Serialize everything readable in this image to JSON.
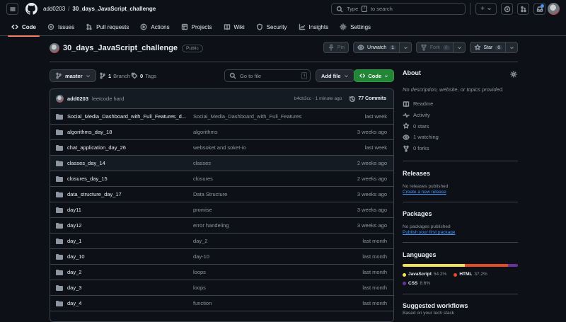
{
  "header": {
    "owner": "add0203",
    "separator": "/",
    "repo": "30_days_JavaScript_challenge",
    "search_prefix": "Type",
    "search_key": "/",
    "search_suffix": "to search",
    "plus_label": "+"
  },
  "tabs": [
    {
      "label": "Code",
      "icon": "code-icon"
    },
    {
      "label": "Issues",
      "icon": "issue-icon"
    },
    {
      "label": "Pull requests",
      "icon": "pull-request-icon"
    },
    {
      "label": "Actions",
      "icon": "play-icon"
    },
    {
      "label": "Projects",
      "icon": "table-icon"
    },
    {
      "label": "Wiki",
      "icon": "book-icon"
    },
    {
      "label": "Security",
      "icon": "shield-icon"
    },
    {
      "label": "Insights",
      "icon": "graph-icon"
    },
    {
      "label": "Settings",
      "icon": "gear-icon"
    }
  ],
  "repo": {
    "name": "30_days_JavaScript_challenge",
    "visibility": "Public",
    "pin_label": "Pin",
    "unwatch_label": "Unwatch",
    "watch_count": "1",
    "fork_label": "Fork",
    "fork_count": "0",
    "star_label": "Star",
    "star_count": "0"
  },
  "branchbar": {
    "branch": "master",
    "branch_count": "1",
    "branch_label": "Branch",
    "tag_count": "0",
    "tag_label": "Tags",
    "goto_placeholder": "Go to file",
    "goto_key": "t",
    "add_file": "Add file",
    "code_button": "Code"
  },
  "latest_commit": {
    "user": "add0203",
    "message": "leetcode hard",
    "hash_time": "b4cb3cc · 1 minute ago",
    "commits": "77 Commits"
  },
  "files": [
    {
      "name": "Social_Media_Dashboard_with_Full_Features_d...",
      "message": "Social_Media_Dashboard_with_Full_Features",
      "date": "last week"
    },
    {
      "name": "algorithms_day_18",
      "message": "algorithms",
      "date": "3 weeks ago"
    },
    {
      "name": "chat_application_day_26",
      "message": "websoket and soket-io",
      "date": "last week"
    },
    {
      "name": "classes_day_14",
      "message": "classes",
      "date": "2 weeks ago"
    },
    {
      "name": "closures_day_15",
      "message": "closures",
      "date": "2 weeks ago"
    },
    {
      "name": "data_structure_day_17",
      "message": "Data Structure",
      "date": "3 weeks ago"
    },
    {
      "name": "day11",
      "message": "promise",
      "date": "3 weeks ago"
    },
    {
      "name": "day12",
      "message": "error handeling",
      "date": "3 weeks ago"
    },
    {
      "name": "day_1",
      "message": "day_2",
      "date": "last month"
    },
    {
      "name": "day_10",
      "message": "day-10",
      "date": "last month"
    },
    {
      "name": "day_2",
      "message": "loops",
      "date": "last month"
    },
    {
      "name": "day_3",
      "message": "loops",
      "date": "last month"
    },
    {
      "name": "day_4",
      "message": "function",
      "date": "last month"
    }
  ],
  "about": {
    "title": "About",
    "description": "No description, website, or topics provided.",
    "links": [
      {
        "label": "Readme",
        "icon": "book-icon"
      },
      {
        "label": "Activity",
        "icon": "pulse-icon"
      },
      {
        "label": "0 stars",
        "icon": "star-icon"
      },
      {
        "label": "1 watching",
        "icon": "eye-icon"
      },
      {
        "label": "0 forks",
        "icon": "fork-icon"
      }
    ]
  },
  "releases": {
    "title": "Releases",
    "note": "No releases published",
    "link": "Create a new release"
  },
  "packages": {
    "title": "Packages",
    "note": "No packages published",
    "link": "Publish your first package"
  },
  "languages": {
    "title": "Languages",
    "items": [
      {
        "name": "JavaScript",
        "percent": "54.2%",
        "value": 54.2,
        "color": "#f1e05a"
      },
      {
        "name": "HTML",
        "percent": "37.2%",
        "value": 37.2,
        "color": "#e34c26"
      },
      {
        "name": "CSS",
        "percent": "8.6%",
        "value": 8.6,
        "color": "#663399"
      }
    ]
  },
  "workflows": {
    "title": "Suggested workflows",
    "sub": "Based on your tech stack"
  },
  "colors": {
    "accent_tab": "#f78166",
    "green": "#238636",
    "link": "#4493f8",
    "bg": "#0d1117"
  }
}
